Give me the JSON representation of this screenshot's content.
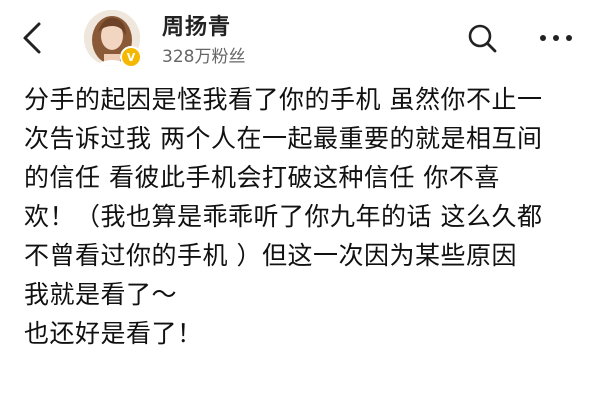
{
  "header": {
    "back_icon": "chevron-left-icon",
    "user_name": "周扬青",
    "followers": "328万粉丝",
    "verified_badge": "V",
    "verified_color": "#f5b800",
    "search_icon": "search-icon",
    "more_icon": "more-horizontal-icon"
  },
  "post": {
    "lines": [
      "分手的起因是怪我看了你的手机  虽然你不止一",
      "次告诉过我  两个人在一起最重要的就是相互间",
      "的信任  看彼此手机会打破这种信任  你不喜",
      "欢！（我也算是乖乖听了你九年的话  这么久都",
      "不曾看过你的手机 ）但这一次因为某些原因",
      "我就是看了～",
      "也还好是看了！"
    ]
  }
}
